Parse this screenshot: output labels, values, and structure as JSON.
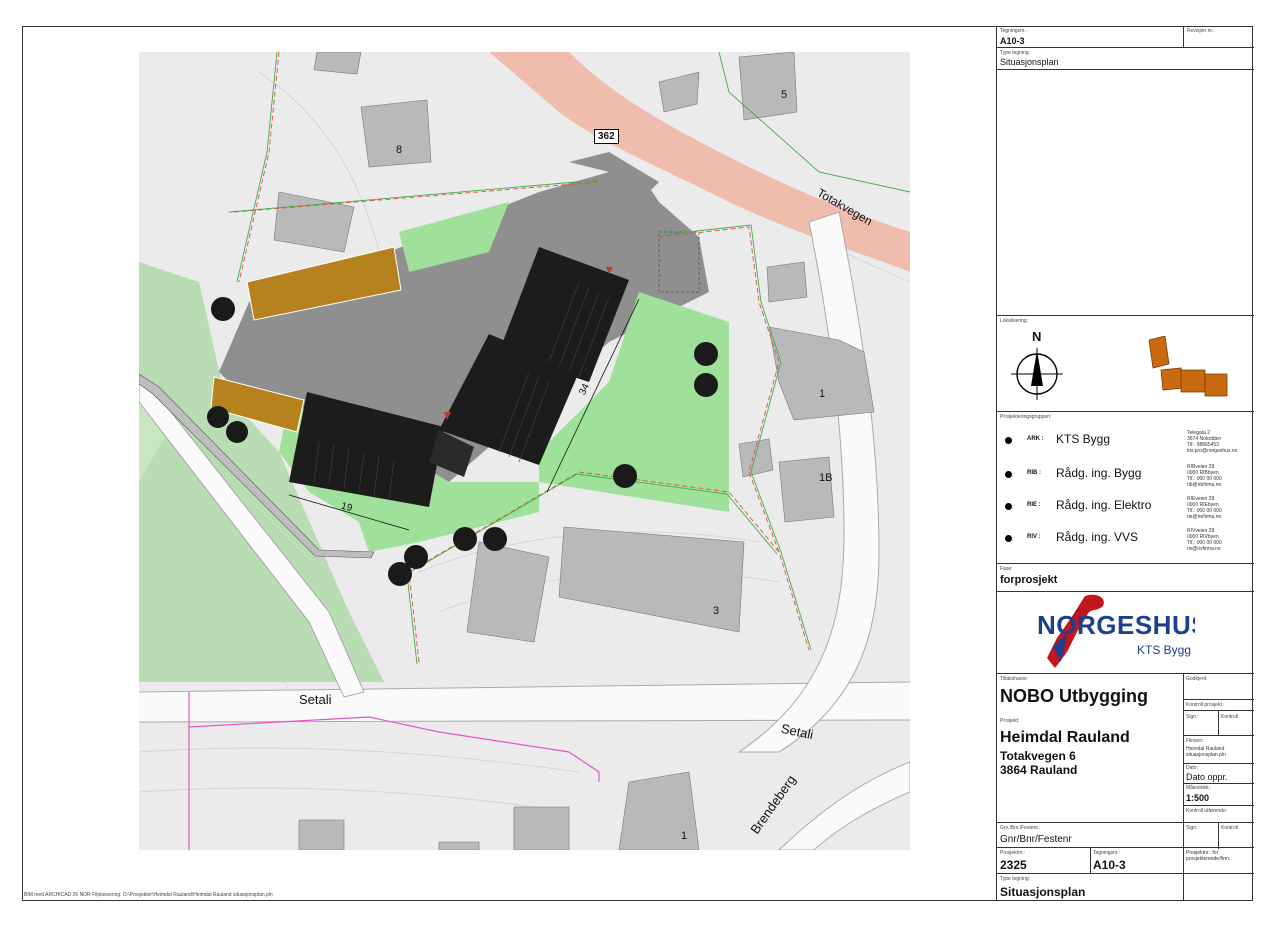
{
  "map": {
    "road_number": "362",
    "roads": {
      "totakvegen": "Totakvegen",
      "setali_left": "Setali",
      "setali_right": "Setali",
      "brendeberg": "Brendeberg"
    },
    "house_numbers": {
      "h8": "8",
      "h5": "5",
      "h1": "1",
      "h1b": "1B",
      "h3": "3",
      "h1_bottom": "1"
    },
    "dimensions": {
      "width": "19",
      "length": "34"
    }
  },
  "title_block": {
    "drawing_no_label": "Tegningsnr.:",
    "drawing_no": "A10-3",
    "revision_label": "Revisjon nr.:",
    "type_label": "Type tegning:",
    "type_value": "Situasjonsplan",
    "localization_label": "Lokalisering:",
    "north": "N",
    "project_group_label": "Prosjekteringsgruppen:",
    "team": [
      {
        "code": "ARK :",
        "name": "KTS Bygg",
        "contact": "Telegata 2\n3674 Notodden\nTlf.: 98865453\nkts.pro@norgeshus.no"
      },
      {
        "code": "RIB :",
        "name": "Rådg. ing. Bygg",
        "contact": "RIBveien 28\n0000 RIBbyen\nTlf.: 000 00 000\nrib@ribfirma.no"
      },
      {
        "code": "RIE :",
        "name": "Rådg. ing. Elektro",
        "contact": "RIEveien 28\n0000 RIEbyen\nTlf.: 000 00 000\nrie@riefirma.no"
      },
      {
        "code": "RIV :",
        "name": "Rådg. ing. VVS",
        "contact": "RIVveien 28\n0000 RIVbyen\nTlf.: 000 00 000\nriv@rivfirma.no"
      }
    ],
    "phase_label": "Fase:",
    "phase_value": "forprosjekt",
    "logo_text": "NORGESHUS",
    "logo_sub": "KTS Bygg",
    "client_label": "Tiltakshaver:",
    "client_value": "NOBO Utbygging",
    "approved_label": "Godkjent:",
    "control_project_label": "Kontroll prosjekt.:",
    "sign_label": "Sign.:",
    "control_label": "Kontroll",
    "project_label": "Prosjekt:",
    "project_name": "Heimdal Rauland",
    "address1": "Totakvegen 6",
    "address2": "3864 Rauland",
    "filename_label": "Filnavn:",
    "filename_value": "Heimdal Rauland\nsituasjonsplan.pln",
    "date_label": "Dato:",
    "date_value": "Dato oppr.",
    "scale_label": "Målestokk:",
    "scale_value": "1:500",
    "control_exec_label": "Kontroll utførende:",
    "sign2_label": "Sign.:",
    "control2_label": "Kontroll",
    "gnr_label": "Gnr./Bnr./Festenr.:",
    "gnr_value": "Gnr/Bnr/Festenr",
    "project_no_label": "Prosjektnr.:",
    "project_no": "2325",
    "drawing_no2_label": "Tegningsnr.:",
    "drawing_no2": "A10-3",
    "project_leader_label": "Prosjektnr.: for\nprosjekterende/firm.",
    "type2_label": "Type tegning:",
    "type2_value": "Situasjonsplan"
  },
  "footer": "BIM med ARCHICAD 26 NOR    Filplassering: O:\\Prosjekter\\Heimdal Rauland\\Heimdal Rauland situasjonsplan.pln",
  "colors": {
    "grass": "#9fe09a",
    "building": "#1c1c1c",
    "asphalt": "#8f8f8f",
    "road": "#f2bdae",
    "wood": "#b5821d"
  }
}
